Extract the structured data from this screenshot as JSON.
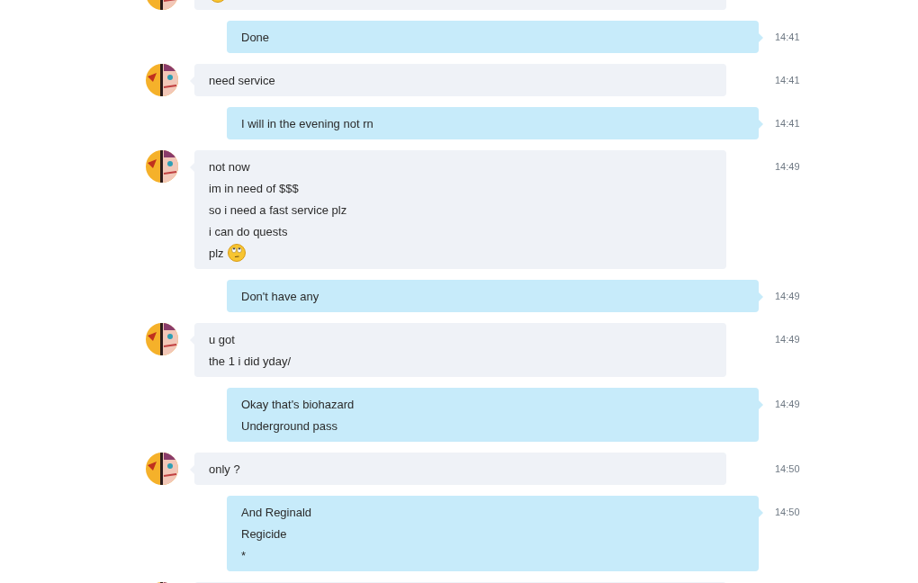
{
  "messages": [
    {
      "kind": "incoming",
      "lines": [
        {
          "emoji": true
        }
      ]
    },
    {
      "kind": "outgoing",
      "time": "14:41",
      "lines": [
        {
          "text": "Done"
        }
      ]
    },
    {
      "kind": "incoming",
      "time": "14:41",
      "lines": [
        {
          "text": "need service"
        }
      ]
    },
    {
      "kind": "outgoing",
      "time": "14:41",
      "lines": [
        {
          "text": "I will in the evening not rn"
        }
      ]
    },
    {
      "kind": "incoming",
      "time": "14:49",
      "lines": [
        {
          "text": "not now"
        },
        {
          "text": "im in need of $$$"
        },
        {
          "text": "so i need a fast service plz"
        },
        {
          "text": "i can do quests"
        },
        {
          "text": "plz",
          "emoji": true
        }
      ]
    },
    {
      "kind": "outgoing",
      "time": "14:49",
      "lines": [
        {
          "text": "Don't have any"
        }
      ]
    },
    {
      "kind": "incoming",
      "time": "14:49",
      "lines": [
        {
          "text": "u got"
        },
        {
          "text": "the 1 i did yday/"
        }
      ]
    },
    {
      "kind": "outgoing",
      "time": "14:49",
      "lines": [
        {
          "text": "Okay that's biohazard"
        },
        {
          "text": "Underground pass"
        }
      ]
    },
    {
      "kind": "incoming",
      "time": "14:50",
      "lines": [
        {
          "text": "only ?"
        }
      ]
    },
    {
      "kind": "outgoing",
      "time": "14:50",
      "lines": [
        {
          "text": "And Reginald"
        },
        {
          "text": "Regicide"
        },
        {
          "text": "*"
        }
      ]
    },
    {
      "kind": "incoming"
    }
  ]
}
